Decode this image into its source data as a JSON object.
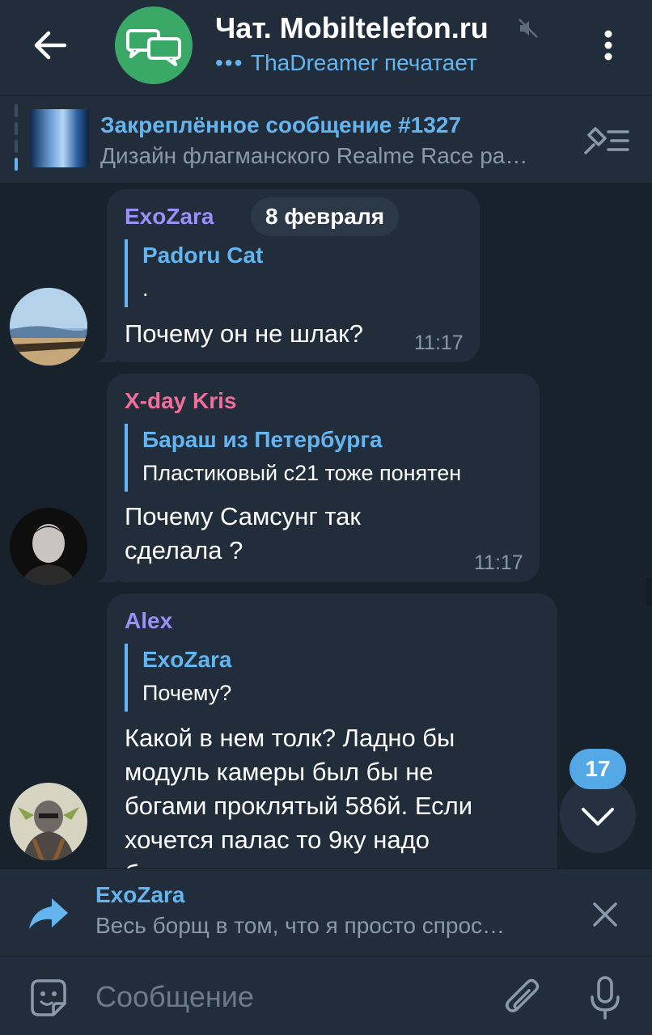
{
  "header": {
    "title": "Чат. Mobiltelefon.ru",
    "typing_dots": "•••",
    "typing_status": "ThaDreamer печатает",
    "avatar_color": "#3aa867"
  },
  "pinned": {
    "title": "Закреплённое сообщение #1327",
    "text": "Дизайн флагманского Realme Race ра…"
  },
  "date_pill": "8 февраля",
  "messages": [
    {
      "sender": "ExoZara",
      "sender_color": "#9b8ffa",
      "reply_name": "Padoru Cat",
      "reply_text": ".",
      "text": "Почему он не шлак?",
      "time": "11:17"
    },
    {
      "sender": "X-day Kris",
      "sender_color": "#f06e9c",
      "reply_name": "Бараш из Петербурга",
      "reply_text": "Пластиковый с21 тоже понятен",
      "text_lines": [
        "Почему Самсунг так",
        "сделала ?"
      ],
      "time": "11:17"
    },
    {
      "sender": "Alex",
      "sender_color": "#9b8ffa",
      "reply_name": "ExoZara",
      "reply_text": "Почему?",
      "text_lines": [
        "Какой в нем толк? Ладно бы",
        "модуль камеры был бы не",
        "богами проклятый 586й. Если",
        "хочется палас то 9ку надо",
        "б"
      ]
    }
  ],
  "unread_count": "17",
  "reply_panel": {
    "name": "ExoZara",
    "text": "Весь борщ в том, что я просто спрос…"
  },
  "composer": {
    "placeholder": "Сообщение"
  },
  "colors": {
    "accent": "#64b5ef",
    "bubble": "#212d3b",
    "background": "#18222d"
  }
}
